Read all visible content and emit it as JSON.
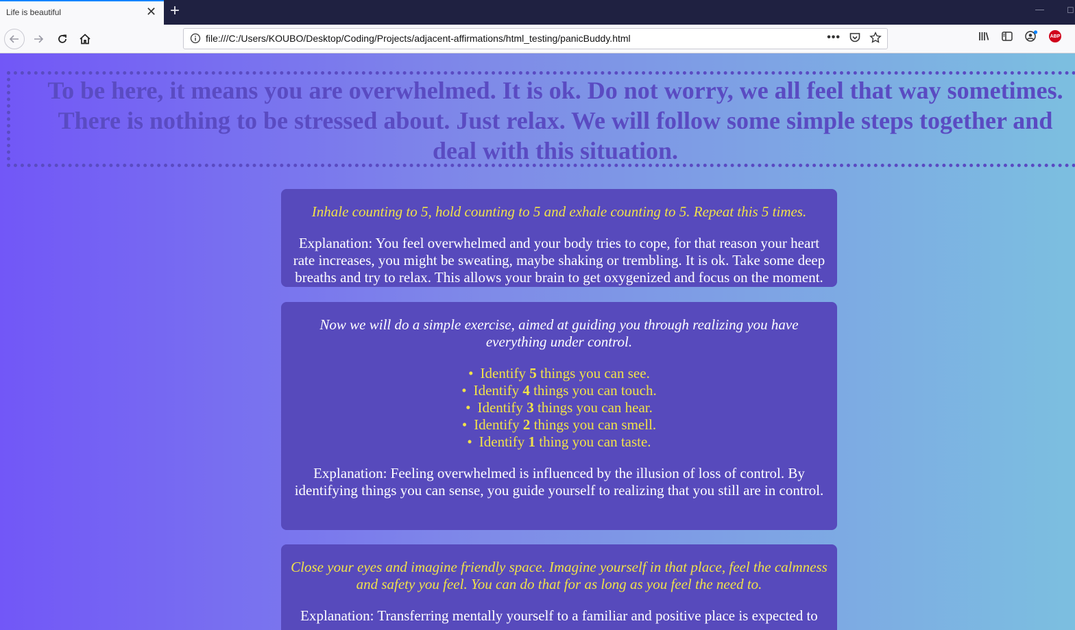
{
  "browser": {
    "tab_title": "Life is beautiful",
    "url": "file:///C:/Users/KOUBO/Desktop/Coding/Projects/adjacent-affirmations/html_testing/panicBuddy.html"
  },
  "header": {
    "line1": "To be here, it means you are overwhelmed. It is ok. Do not worry, we all feel that way sometimes.",
    "line2": "There is nothing to be stressed about. Just relax. We will follow some simple steps together and",
    "line3": "deal with this situation."
  },
  "cards": [
    {
      "instruction": "Inhale counting to 5, hold counting to 5 and exhale counting to 5. Repeat this 5 times.",
      "explanation_lines": [
        "Explanation: You feel overwhelmed and your body tries to cope, for that reason your heart",
        "rate increases, you might be sweating, maybe shaking or trembling. It is ok. Take some deep",
        "breaths and try to relax. This allows your brain to get oxygenized and focus on the moment."
      ]
    },
    {
      "instruction_lines": [
        "Now we will do a simple exercise, aimed at guiding you through realizing you have",
        "everything under control."
      ],
      "steps": [
        {
          "prefix": "Identify ",
          "num": "5",
          "suffix": " things you can see."
        },
        {
          "prefix": "Identify ",
          "num": "4",
          "suffix": " things you can touch."
        },
        {
          "prefix": "Identify ",
          "num": "3",
          "suffix": " things you can hear."
        },
        {
          "prefix": "Identify ",
          "num": "2",
          "suffix": " things you can smell."
        },
        {
          "prefix": "Identify ",
          "num": "1",
          "suffix": " thing you can taste."
        }
      ],
      "explanation_lines": [
        "Explanation: Feeling overwhelmed is influenced by the illusion of loss of control. By",
        "identifying things you can sense, you guide yourself to realizing that you still are in control."
      ]
    },
    {
      "instruction_lines": [
        "Close your eyes and imagine friendly space. Imagine yourself in that place, feel the calmness",
        "and safety you feel. You can do that for as long as you feel the need to."
      ],
      "explanation_lines": [
        "Explanation: Transferring mentally yourself to a familiar and positive place is expected to"
      ]
    }
  ],
  "colors": {
    "card_bg": "#574abc",
    "instruction": "#f0e14a",
    "header_text": "#5a4bc2",
    "gradient_start": "#7257f7",
    "gradient_end": "#7cbfe0"
  }
}
